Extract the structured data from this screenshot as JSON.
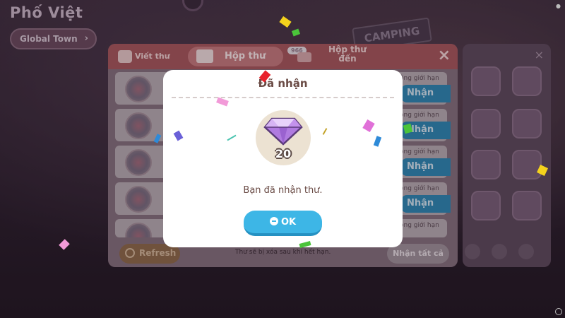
{
  "world": {
    "town_name": "Phố Việt",
    "town_button": "Global Town",
    "camping_sign": "CAMPING"
  },
  "mailbox": {
    "tab_write": "Viết thư",
    "tab_inbox": "Hộp thư",
    "inbox_count": "966",
    "tab_sent": "Hộp thư đến",
    "rows": [
      {
        "limit": "ông giới hạn",
        "claim": "Nhận"
      },
      {
        "limit": "ông giới hạn",
        "claim": "Nhận"
      },
      {
        "limit": "ông giới hạn",
        "claim": "Nhận"
      },
      {
        "limit": "ông giới hạn",
        "claim": "Nhận"
      },
      {
        "limit": "ông giới hạn",
        "claim": ""
      }
    ],
    "refresh": "Refresh",
    "footer_note": "Thư sẽ bị xóa sau khi hết hạn.",
    "claim_all": "Nhận tất cả"
  },
  "modal": {
    "title": "Đã nhận",
    "reward_icon": "purple-gem-icon",
    "reward_qty": "20",
    "message": "Bạn đã nhận thư.",
    "ok_label": "OK"
  },
  "colors": {
    "ok_button": "#3db6e6",
    "header_red": "#a9575c",
    "claim_blue": "#2e87b5",
    "gem_purple": "#b07be0"
  }
}
